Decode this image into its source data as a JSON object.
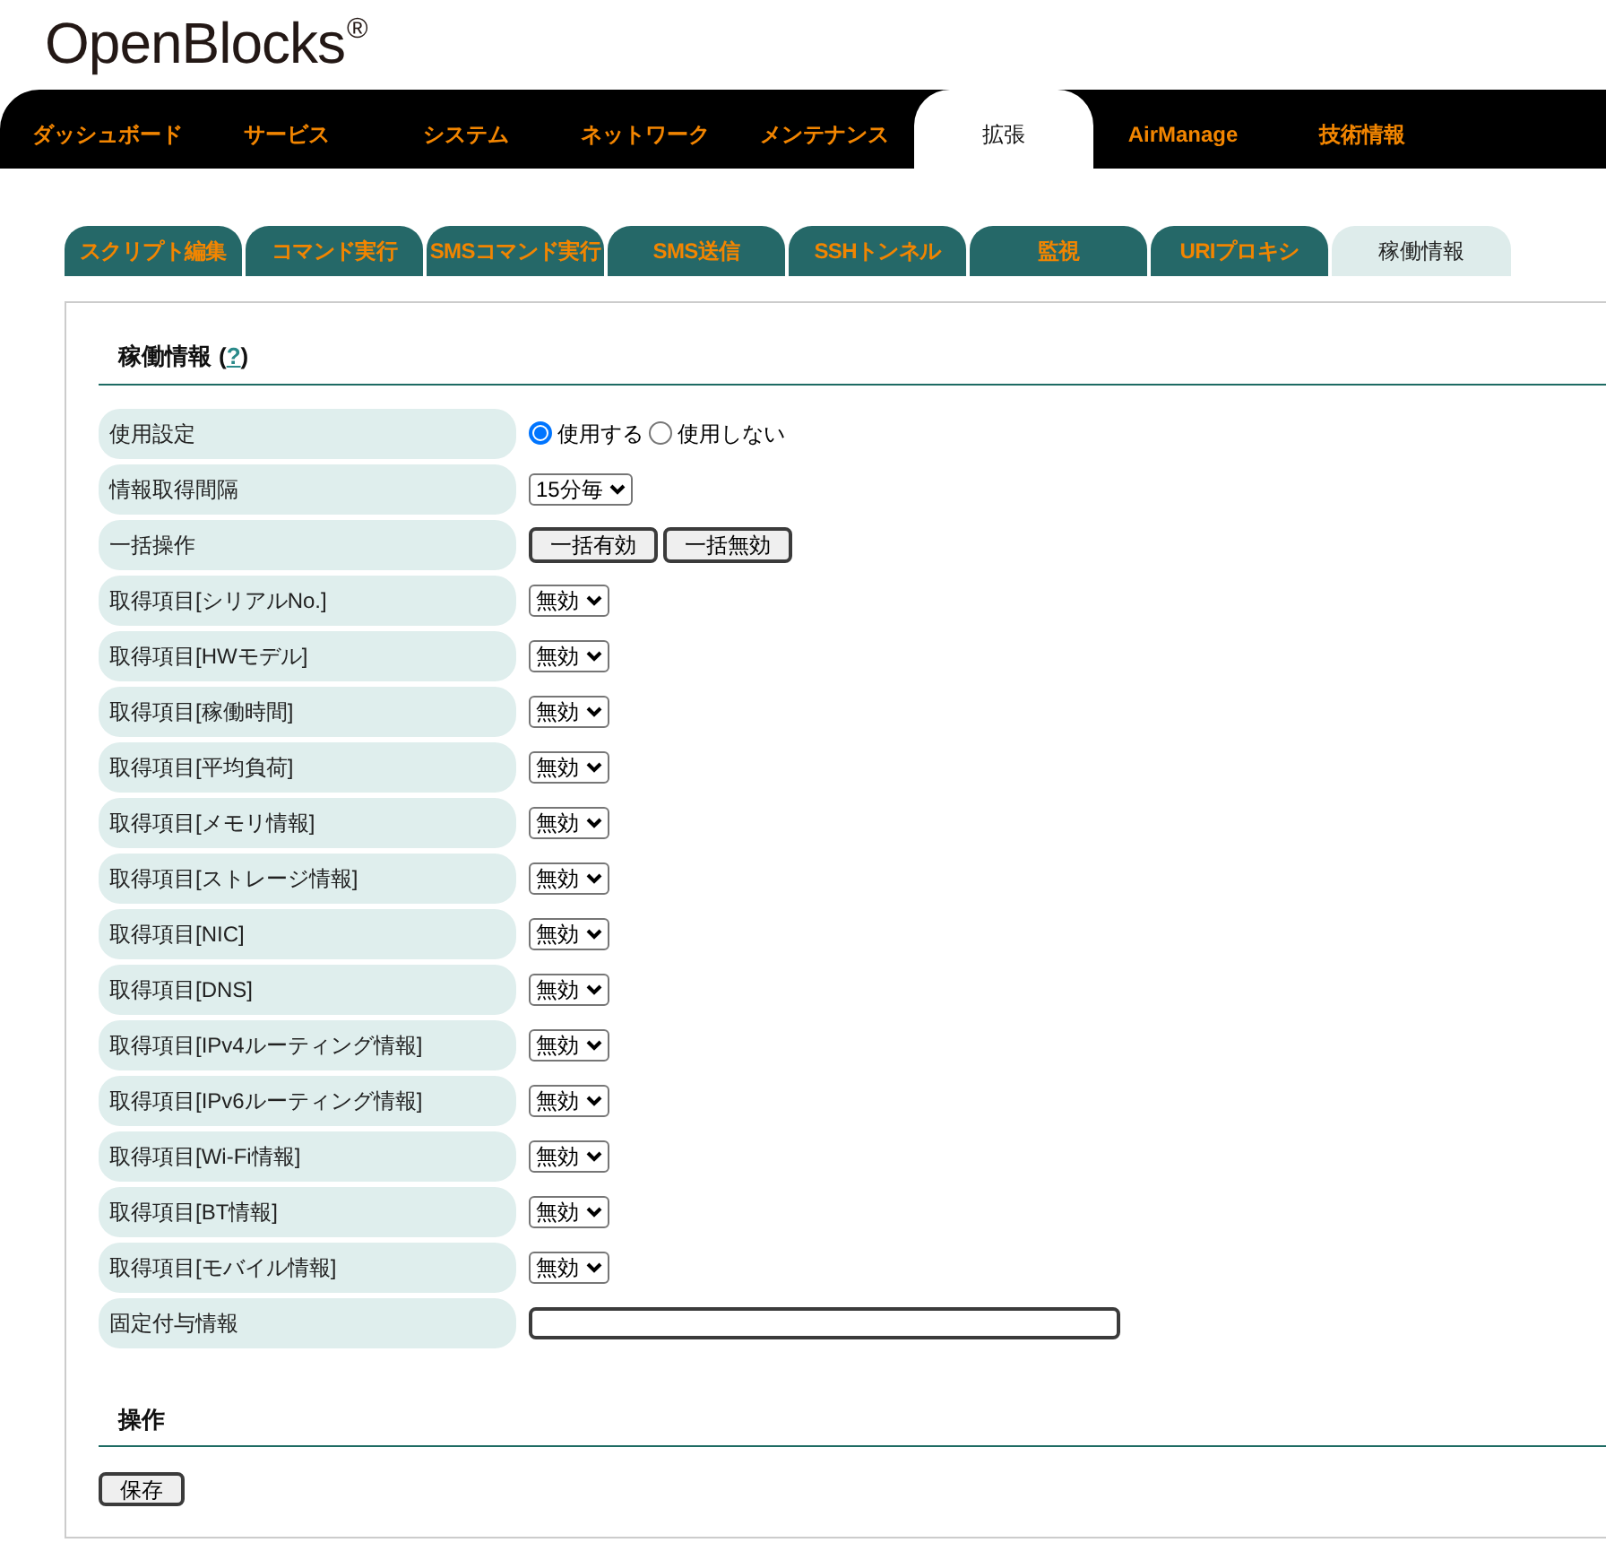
{
  "logo": {
    "text": "OpenBlocks$^{®}$"
  },
  "main_nav": [
    {
      "label": "ダッシュボード",
      "selected": false
    },
    {
      "label": "サービス",
      "selected": false
    },
    {
      "label": "システム",
      "selected": false
    },
    {
      "label": "ネットワーク",
      "selected": false
    },
    {
      "label": "メンテナンス",
      "selected": false
    },
    {
      "label": "拡張",
      "selected": true
    },
    {
      "label": "AirManage",
      "selected": false
    },
    {
      "label": "技術情報",
      "selected": false
    }
  ],
  "sub_tabs": [
    {
      "label": "スクリプト編集",
      "selected": false
    },
    {
      "label": "コマンド実行",
      "selected": false
    },
    {
      "label": "SMSコマンド実行",
      "selected": false
    },
    {
      "label": "SMS送信",
      "selected": false
    },
    {
      "label": "SSHトンネル",
      "selected": false
    },
    {
      "label": "監視",
      "selected": false
    },
    {
      "label": "URIプロキシ",
      "selected": false
    },
    {
      "label": "稼働情報",
      "selected": true
    }
  ],
  "status_section": {
    "title": "稼働情報",
    "help": {
      "open": "(",
      "link": "?",
      "close": ")"
    },
    "rows": [
      {
        "label": "使用設定",
        "kind": "radio",
        "options": [
          {
            "label": "使用する",
            "selected": true
          },
          {
            "label": "使用しない",
            "selected": false
          }
        ]
      },
      {
        "label": "情報取得間隔",
        "kind": "select",
        "value": "15分毎"
      },
      {
        "label": "一括操作",
        "kind": "buttons",
        "buttons": [
          "一括有効",
          "一括無効"
        ]
      },
      {
        "label": "取得項目[シリアルNo.]",
        "kind": "select",
        "value": "無効"
      },
      {
        "label": "取得項目[HWモデル]",
        "kind": "select",
        "value": "無効"
      },
      {
        "label": "取得項目[稼働時間]",
        "kind": "select",
        "value": "無効"
      },
      {
        "label": "取得項目[平均負荷]",
        "kind": "select",
        "value": "無効"
      },
      {
        "label": "取得項目[メモリ情報]",
        "kind": "select",
        "value": "無効"
      },
      {
        "label": "取得項目[ストレージ情報]",
        "kind": "select",
        "value": "無効"
      },
      {
        "label": "取得項目[NIC]",
        "kind": "select",
        "value": "無効"
      },
      {
        "label": "取得項目[DNS]",
        "kind": "select",
        "value": "無効"
      },
      {
        "label": "取得項目[IPv4ルーティング情報]",
        "kind": "select",
        "value": "無効"
      },
      {
        "label": "取得項目[IPv6ルーティング情報]",
        "kind": "select",
        "value": "無効"
      },
      {
        "label": "取得項目[Wi-Fi情報]",
        "kind": "select",
        "value": "無効"
      },
      {
        "label": "取得項目[BT情報]",
        "kind": "select",
        "value": "無効"
      },
      {
        "label": "取得項目[モバイル情報]",
        "kind": "select",
        "value": "無効"
      },
      {
        "label": "固定付与情報",
        "kind": "text"
      }
    ]
  },
  "action_section": {
    "title": "操作",
    "buttons": [
      "保存"
    ]
  }
}
